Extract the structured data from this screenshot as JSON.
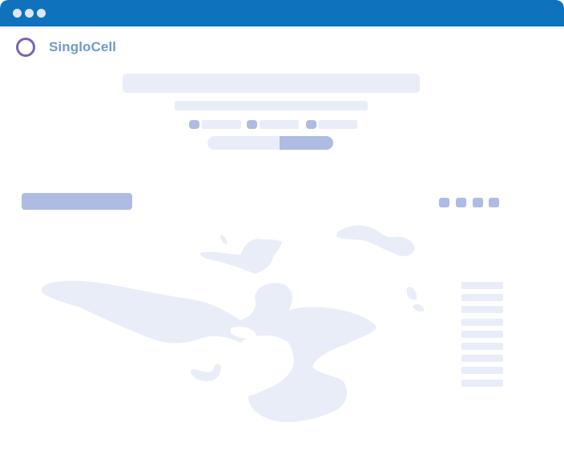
{
  "app": {
    "brand_name": "SingloCell"
  },
  "colors": {
    "titlebar": "#0e72bd",
    "brand_text": "#6f98d6",
    "logo_ring": "#7b63b2",
    "placeholder_light": "#e9edf8",
    "placeholder_dark": "#aebbe2",
    "plot_fill": "#e8edf8"
  },
  "icons": {
    "window_controls": [
      "window-dot-icon",
      "window-dot-icon",
      "window-dot-icon"
    ],
    "logo": "ring-logo-icon"
  }
}
